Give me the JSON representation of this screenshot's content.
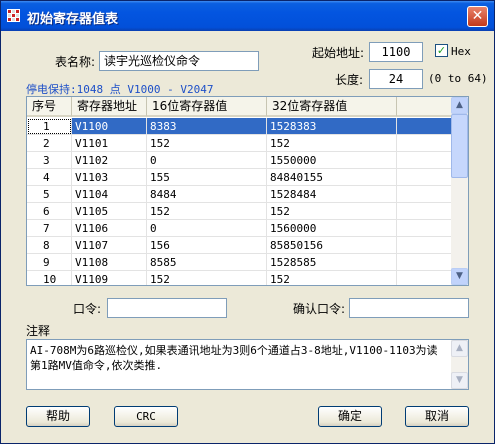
{
  "window": {
    "title": "初始寄存器值表",
    "close_glyph": "✕"
  },
  "form": {
    "table_name_label": "表名称:",
    "table_name_value": "读宇光巡检仪命令",
    "start_address_label": "起始地址:",
    "start_address_value": "1100",
    "hex_label": "Hex",
    "hex_checked": true,
    "length_label": "长度:",
    "length_value": "24",
    "length_range": "(0 to 64)",
    "retain_info": "停电保持:1048 点 V1000 - V2047",
    "password_label": "口令:",
    "password_value": "",
    "confirm_password_label": "确认口令:",
    "confirm_password_value": ""
  },
  "table": {
    "headers": [
      "序号",
      "寄存器地址",
      "16位寄存器值",
      "32位寄存器值"
    ],
    "selected_row": 0,
    "rows": [
      [
        "1",
        "V1100",
        "8383",
        "1528383"
      ],
      [
        "2",
        "V1101",
        "152",
        "152"
      ],
      [
        "3",
        "V1102",
        "0",
        "1550000"
      ],
      [
        "4",
        "V1103",
        "155",
        "84840155"
      ],
      [
        "5",
        "V1104",
        "8484",
        "1528484"
      ],
      [
        "6",
        "V1105",
        "152",
        "152"
      ],
      [
        "7",
        "V1106",
        "0",
        "1560000"
      ],
      [
        "8",
        "V1107",
        "156",
        "85850156"
      ],
      [
        "9",
        "V1108",
        "8585",
        "1528585"
      ],
      [
        "10",
        "V1109",
        "152",
        "152"
      ]
    ]
  },
  "notes": {
    "label": "注释",
    "text": "AI-708M为6路巡检仪,如果表通讯地址为3则6个通道占3-8地址,V1100-1103为读第1路MV值命令,依次类推."
  },
  "buttons": {
    "help": "帮助",
    "crc": "CRC",
    "ok": "确定",
    "cancel": "取消"
  },
  "icons": {
    "title": "app-grid-icon",
    "close": "close-icon",
    "scroll_up": "chevron-up-icon",
    "scroll_down": "chevron-down-icon",
    "checkbox": "checkmark-icon"
  },
  "colors": {
    "titlebar": "#0355e0",
    "selection": "#316ac5",
    "info_text": "#1e50c8",
    "dialog_bg": "#ece9d8"
  }
}
